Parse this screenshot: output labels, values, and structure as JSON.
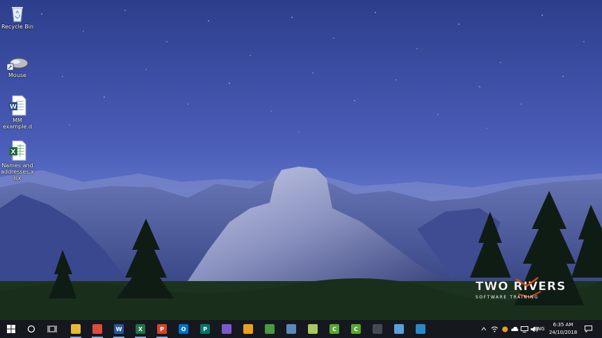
{
  "desktop": {
    "icons": [
      {
        "label": "Recycle Bin",
        "icon": "recycle-bin-icon"
      },
      {
        "label": "Mouse",
        "icon": "mouse-shortcut-icon"
      },
      {
        "label": "MM example.d",
        "icon": "word-document-icon"
      },
      {
        "label": "Names and addresses.xlsx",
        "icon": "excel-workbook-icon"
      }
    ],
    "logo": {
      "name": "TWO RIVERS",
      "tagline": "SOFTWARE TRAINING"
    }
  },
  "taskbar": {
    "start": "windows-start-icon",
    "search": "cortana-search-icon",
    "taskview": "task-view-icon",
    "apps": [
      {
        "name": "file-explorer-icon",
        "color": "#e8b838",
        "glyph": ""
      },
      {
        "name": "chrome-icon",
        "color": "#dd4b3e",
        "glyph": ""
      },
      {
        "name": "word-icon",
        "color": "#2b579a",
        "glyph": "W"
      },
      {
        "name": "excel-icon",
        "color": "#217346",
        "glyph": "X"
      },
      {
        "name": "powerpoint-icon",
        "color": "#d24726",
        "glyph": "P"
      },
      {
        "name": "outlook-icon",
        "color": "#0072c6",
        "glyph": "O"
      },
      {
        "name": "publisher-icon",
        "color": "#077568",
        "glyph": "P"
      },
      {
        "name": "paint-icon",
        "color": "#7a5ac8",
        "glyph": ""
      },
      {
        "name": "game-icon",
        "color": "#e8a020",
        "glyph": ""
      },
      {
        "name": "paint-3d-icon",
        "color": "#4a9a40",
        "glyph": ""
      },
      {
        "name": "notepad-icon",
        "color": "#5a8ab8",
        "glyph": ""
      },
      {
        "name": "sticky-notes-icon",
        "color": "#a8c860",
        "glyph": ""
      },
      {
        "name": "camtasia-icon",
        "color": "#56a830",
        "glyph": "C"
      },
      {
        "name": "camtasia-recorder-icon",
        "color": "#56a830",
        "glyph": "C"
      },
      {
        "name": "calculator-icon",
        "color": "#444b55",
        "glyph": ""
      },
      {
        "name": "snipping-tool-icon",
        "color": "#5aa0d8",
        "glyph": ""
      },
      {
        "name": "defender-icon",
        "color": "#2a88c8",
        "glyph": ""
      }
    ],
    "tray": {
      "language": "ENG",
      "time": "6:35 AM",
      "date": "24/10/2018"
    }
  }
}
